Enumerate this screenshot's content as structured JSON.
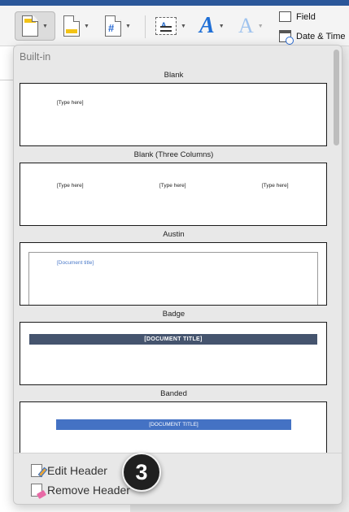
{
  "ribbon": {
    "tools": {
      "field_label": "Field",
      "date_time_label": "Date & Time"
    },
    "icons": [
      "header-icon",
      "footer-icon",
      "page-number-icon",
      "text-box-icon",
      "wordart-icon",
      "drop-cap-icon",
      "field-icon",
      "date-time-icon"
    ],
    "wordart_glyph": "A",
    "dropcap_glyph": "A",
    "page_number_glyph": "#",
    "textbox_glyph": "A"
  },
  "dropdown": {
    "section_label": "Built-in",
    "items": [
      {
        "title": "Blank",
        "placeholders": [
          "[Type here]"
        ]
      },
      {
        "title": "Blank (Three Columns)",
        "placeholders": [
          "[Type here]",
          "[Type here]",
          "[Type here]"
        ]
      },
      {
        "title": "Austin",
        "placeholders": [
          "[Document title]"
        ]
      },
      {
        "title": "Badge",
        "placeholders": [
          "[DOCUMENT TITLE]"
        ]
      },
      {
        "title": "Banded",
        "placeholders": [
          "[DOCUMENT TITLE]"
        ]
      }
    ],
    "footer": {
      "edit_label": "Edit Header",
      "remove_label": "Remove Header"
    }
  },
  "callout": {
    "number": "3"
  },
  "colors": {
    "title_bar": "#2b579a",
    "badge_bar": "#45546e",
    "banded_bar": "#4472c4",
    "accent_blue": "#1f6fd6"
  }
}
